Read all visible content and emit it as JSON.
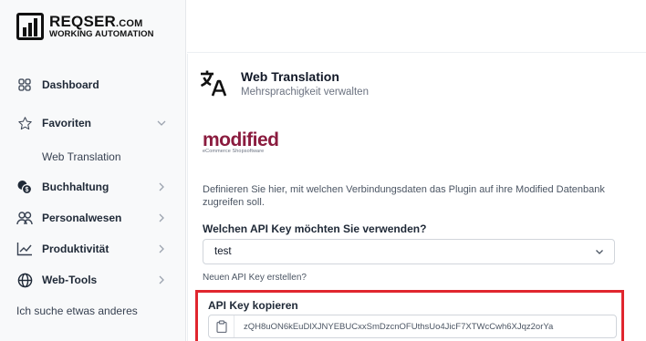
{
  "brand": {
    "name_main": "REQSER",
    "name_suffix": ".COM",
    "subtitle": "WORKING AUTOMATION"
  },
  "sidebar": {
    "items": [
      {
        "label": "Dashboard",
        "icon": "grid-icon"
      },
      {
        "label": "Favoriten",
        "icon": "star-icon",
        "expanded": true
      },
      {
        "label": "Buchhaltung",
        "icon": "coins-icon"
      },
      {
        "label": "Personalwesen",
        "icon": "users-icon"
      },
      {
        "label": "Produktivität",
        "icon": "chart-line-icon"
      },
      {
        "label": "Web-Tools",
        "icon": "globe-icon"
      }
    ],
    "sub_items": [
      {
        "label": "Web Translation"
      }
    ],
    "other_link": "Ich suche etwas anderes"
  },
  "page": {
    "icon": "translate-icon",
    "title": "Web Translation",
    "subtitle": "Mehrsprachigkeit verwalten"
  },
  "logo": {
    "word_part1": "modi",
    "word_part2": "fied",
    "tagline": "eCommerce Shopsoftware",
    "color": "#8b1c3f"
  },
  "content": {
    "description": "Definieren Sie hier, mit welchen Verbindungsdaten das Plugin auf ihre Modified Datenbank zugreifen soll.",
    "question": "Welchen API Key möchten Sie verwenden?",
    "selected_key": "test",
    "create_link": "Neuen API Key erstellen?",
    "copy_label": "API Key kopieren",
    "api_key": "zQH8uON6kEuDlXJNYEBUCxxSmDzcnOFUthsUo4JicF7XTWcCwh6XJqz2orYa"
  },
  "colors": {
    "highlight": "#e0262e",
    "sidebar_bg": "#f8f9fa",
    "text": "#1f2937"
  }
}
